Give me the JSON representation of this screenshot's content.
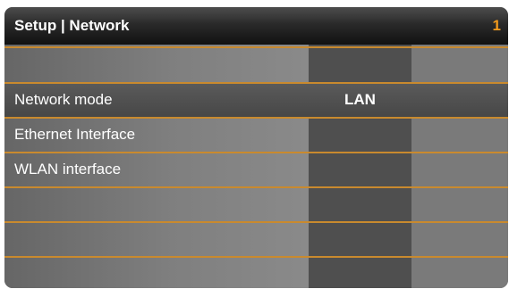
{
  "header": {
    "title": "Setup | Network",
    "page_number": "1"
  },
  "menu": {
    "items": [
      {
        "label": "Network mode",
        "value": "LAN",
        "selected": true
      },
      {
        "label": "Ethernet Interface",
        "value": "",
        "selected": false
      },
      {
        "label": "WLAN interface",
        "value": "",
        "selected": false
      }
    ]
  },
  "colors": {
    "accent": "#f29a1c",
    "divider": "#c98a2e",
    "titlebar": "#1a1a1a",
    "selected_row": "#4f4f4f"
  }
}
